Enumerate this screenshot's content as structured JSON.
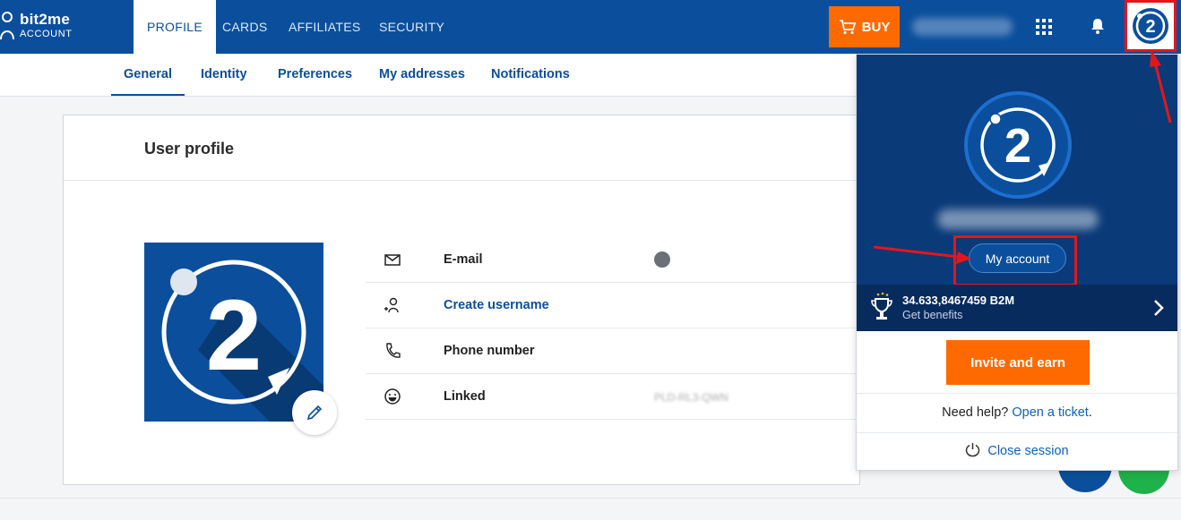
{
  "brand": {
    "name": "bit2me",
    "sub": "ACCOUNT"
  },
  "topnav": {
    "tabs": [
      "PROFILE",
      "CARDS",
      "AFFILIATES",
      "SECURITY"
    ],
    "buy_label": "BUY"
  },
  "subnav": {
    "tabs": [
      "General",
      "Identity",
      "Preferences",
      "My addresses",
      "Notifications"
    ]
  },
  "profile": {
    "title": "User profile",
    "rows": [
      {
        "label": "E-mail",
        "icon": "mail-icon"
      },
      {
        "label": "Create username",
        "icon": "add-user-icon"
      },
      {
        "label": "Phone number",
        "icon": "phone-icon"
      },
      {
        "label": "Linked",
        "icon": "smile-icon",
        "value": "PLD-RL3-QWN"
      }
    ]
  },
  "dropdown": {
    "my_account_label": "My account",
    "points": "34.633,8467459 B2M",
    "points_sub": "Get benefits",
    "invite_label": "Invite and earn",
    "help_text": "Need help?",
    "help_link": "Open a ticket",
    "help_end": ".",
    "close_label": "Close session"
  },
  "colors": {
    "primary": "#0b4f9c",
    "accent": "#ff6a00",
    "highlight": "#e4161c",
    "dark_panel": "#0a3a78"
  }
}
